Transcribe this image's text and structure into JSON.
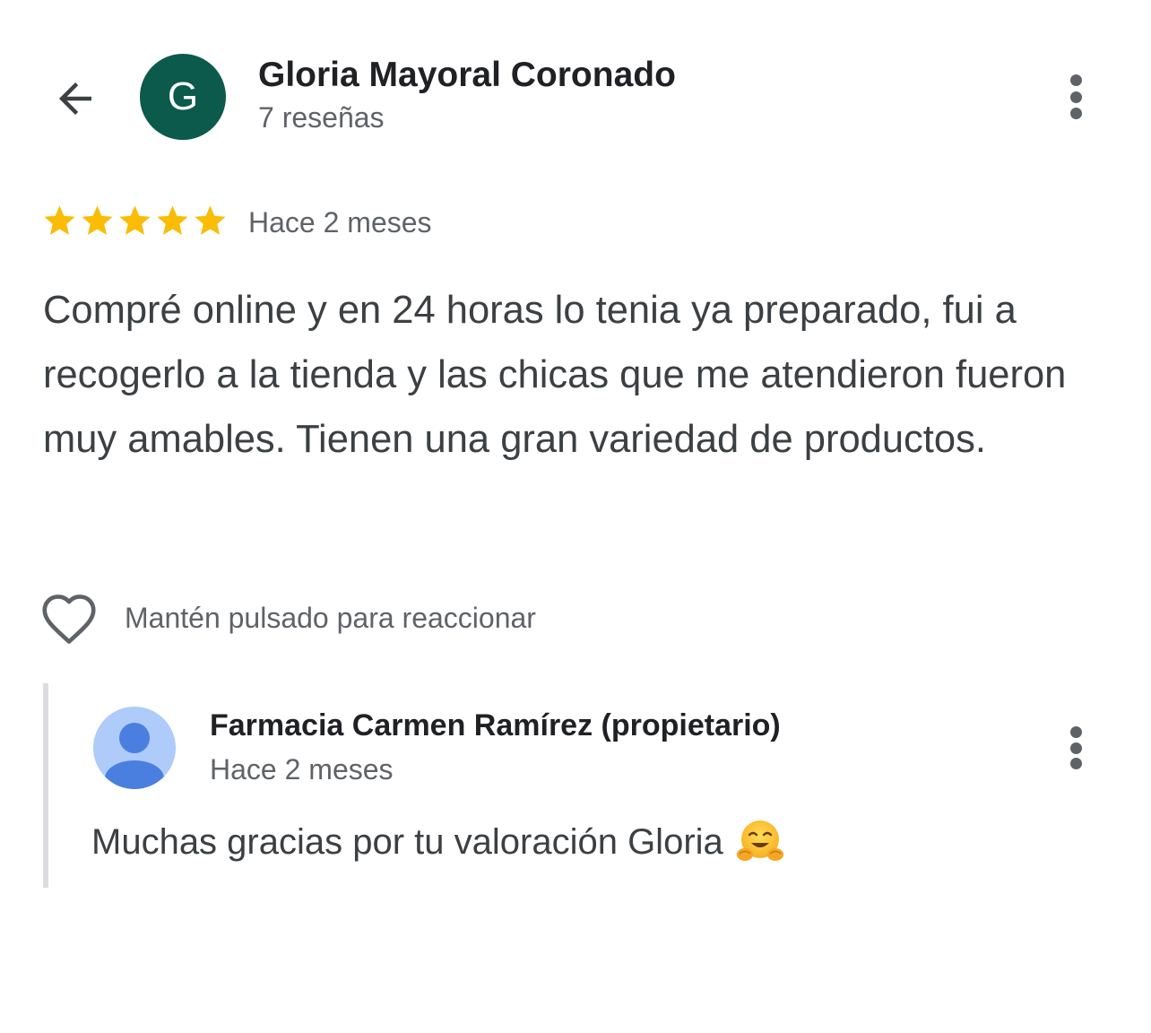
{
  "header": {
    "back_icon": "arrow-left-icon",
    "avatar_letter": "G",
    "avatar_color": "#0b5a4b",
    "reviewer_name": "Gloria Mayoral Coronado",
    "reviewer_reviews_count": "7 reseñas",
    "menu_icon": "more-vertical-icon"
  },
  "review": {
    "rating": 5,
    "rating_max": 5,
    "star_color": "#fbbc04",
    "date": "Hace 2 meses",
    "text": "Compré online y en 24 horas lo tenia ya preparado, fui a recogerlo a la tienda y las chicas que me atendieron fueron muy amables. Tienen una gran variedad de productos."
  },
  "reaction": {
    "icon": "heart-outline-icon",
    "hint": "Mantén pulsado para reaccionar"
  },
  "owner_reply": {
    "name": "Farmacia Carmen Ramírez (propietario)",
    "date": "Hace 2 meses",
    "text": "Muchas gracias por tu valoración Gloria",
    "emoji": "hugging-face-emoji",
    "avatar_icon": "default-person-avatar-icon",
    "menu_icon": "more-vertical-icon"
  }
}
